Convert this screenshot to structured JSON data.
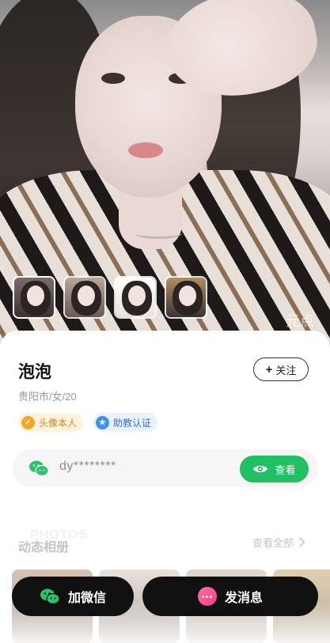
{
  "hero": {
    "watermark": "元点"
  },
  "thumbnails": [
    {
      "label": "photo-1"
    },
    {
      "label": "photo-2"
    },
    {
      "label": "photo-3"
    },
    {
      "label": "photo-4"
    }
  ],
  "profile": {
    "name": "泡泡",
    "meta": "贵阳市/女/20",
    "follow_label": "关注",
    "badges": [
      {
        "label": "头像本人",
        "icon": "check-badge-icon",
        "color": "#f5a623"
      },
      {
        "label": "助教认证",
        "icon": "star-badge-icon",
        "color": "#3e8ef7"
      }
    ]
  },
  "wechat": {
    "masked_id": "dy********",
    "view_label": "查看",
    "accent": "#20c063"
  },
  "album": {
    "watermark_word": "PHOTOS",
    "title": "动态相册",
    "view_all": "查看全部"
  },
  "actions": {
    "add_wechat": "加微信",
    "send_message": "发消息"
  }
}
